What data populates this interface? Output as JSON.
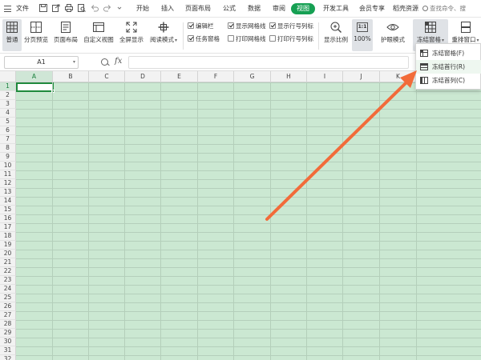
{
  "menubar": {
    "file_label": "文件",
    "tabs": [
      {
        "label": "开始",
        "active": false
      },
      {
        "label": "插入",
        "active": false
      },
      {
        "label": "页面布局",
        "active": false
      },
      {
        "label": "公式",
        "active": false
      },
      {
        "label": "数据",
        "active": false
      },
      {
        "label": "审阅",
        "active": false
      },
      {
        "label": "视图",
        "active": true
      },
      {
        "label": "开发工具",
        "active": false
      },
      {
        "label": "会员专享",
        "active": false
      },
      {
        "label": "稻壳资源",
        "active": false
      }
    ],
    "search_placeholder": "查找命令、搜",
    "quick_access_icons": [
      "save-icon",
      "export-icon",
      "print-icon",
      "print-preview-icon",
      "undo-icon",
      "redo-icon",
      "more-icon"
    ]
  },
  "ribbon": {
    "normal": "普通",
    "page_break": "分页预览",
    "page_layout": "页面布局",
    "custom_view": "自定义视图",
    "full_screen": "全屏显示",
    "reading_mode": "阅读模式",
    "checkboxes": {
      "edit_bar": {
        "label": "编辑栏",
        "checked": true
      },
      "task_pane": {
        "label": "任务窗格",
        "checked": true
      },
      "show_gridlines": {
        "label": "显示网格线",
        "checked": true
      },
      "print_gridlines": {
        "label": "打印网格线",
        "checked": false
      },
      "show_headers": {
        "label": "显示行号列标",
        "checked": true
      },
      "print_headers": {
        "label": "打印行号列标",
        "checked": false
      }
    },
    "zoom_ratio": "显示比例",
    "zoom_100": "100%",
    "zoom_100_icon_text": "1:1",
    "eye_protection": "护眼模式",
    "freeze_panes": "冻结窗格",
    "rearrange_windows": "重排窗口"
  },
  "formula_bar": {
    "cell_ref": "A1",
    "fx": "fx",
    "formula_value": ""
  },
  "grid": {
    "columns": [
      "A",
      "B",
      "C",
      "D",
      "E",
      "F",
      "G",
      "H",
      "I",
      "J",
      "K"
    ],
    "rows": [
      "1",
      "2",
      "3",
      "4",
      "5",
      "6",
      "7",
      "8",
      "9",
      "10",
      "11",
      "12",
      "13",
      "14",
      "15",
      "16",
      "17",
      "18",
      "19",
      "20",
      "21",
      "22",
      "23",
      "24",
      "25",
      "26",
      "27",
      "28",
      "29",
      "30",
      "31",
      "32"
    ],
    "selected_cell": "A1",
    "cell_color": "#cbe8d2"
  },
  "dropdown": {
    "items": [
      {
        "label": "冻结窗格(F)",
        "icon": "freeze-panes-icon"
      },
      {
        "label": "冻结首行(R)",
        "icon": "freeze-top-row-icon"
      },
      {
        "label": "冻结首列(C)",
        "icon": "freeze-first-column-icon"
      }
    ]
  },
  "colors": {
    "accent": "#16a053",
    "arrow": "#f26b3a",
    "sheet_green": "#cbe8d2"
  }
}
